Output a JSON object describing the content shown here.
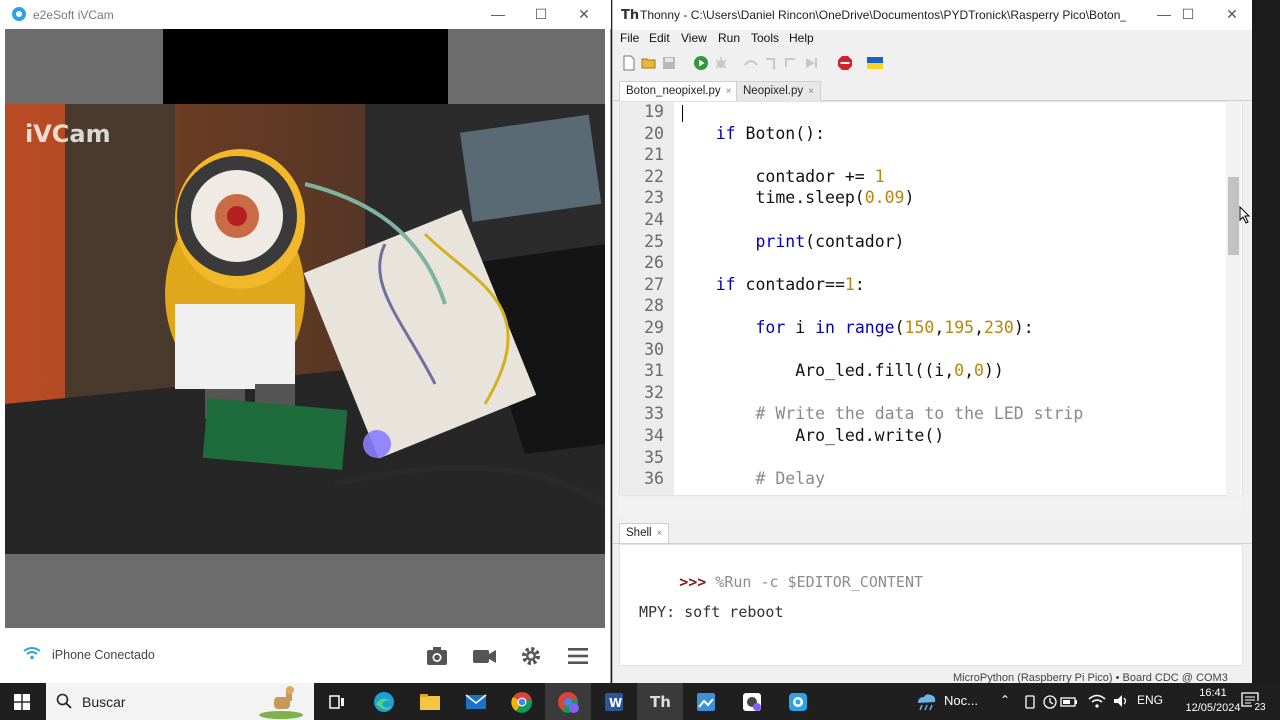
{
  "ivcam": {
    "title": "e2eSoft iVCam",
    "watermark": "iVCam",
    "status": "iPhone Conectado",
    "controls": {
      "minimize": "—",
      "maximize": "☐",
      "close": "✕"
    }
  },
  "thonny": {
    "title": "Thonny  -  C:\\Users\\Daniel Rincon\\OneDrive\\Documentos\\PYDTronick\\Rasperry Pico\\Boton_ne...",
    "menu": [
      "File",
      "Edit",
      "View",
      "Run",
      "Tools",
      "Help"
    ],
    "tabs": [
      {
        "label": "Boton_neopixel.py",
        "close": "×"
      },
      {
        "label": "Neopixel.py",
        "close": "×"
      }
    ],
    "code_lines": [
      {
        "n": "19",
        "text": ""
      },
      {
        "n": "20",
        "text": "    if Boton():"
      },
      {
        "n": "21",
        "text": ""
      },
      {
        "n": "22",
        "text": "        contador += 1"
      },
      {
        "n": "23",
        "text": "        time.sleep(0.09)"
      },
      {
        "n": "24",
        "text": ""
      },
      {
        "n": "25",
        "text": "        print(contador)"
      },
      {
        "n": "26",
        "text": ""
      },
      {
        "n": "27",
        "text": "    if contador==1:"
      },
      {
        "n": "28",
        "text": ""
      },
      {
        "n": "29",
        "text": "        for i in range(150,195,230):"
      },
      {
        "n": "30",
        "text": ""
      },
      {
        "n": "31",
        "text": "            Aro_led.fill((i,0,0))"
      },
      {
        "n": "32",
        "text": ""
      },
      {
        "n": "33",
        "text": "        # Write the data to the LED strip"
      },
      {
        "n": "34",
        "text": "            Aro_led.write()"
      },
      {
        "n": "35",
        "text": ""
      },
      {
        "n": "36",
        "text": "        # Delay"
      }
    ],
    "shell": {
      "tab_label": "Shell",
      "prompt": ">>>",
      "command": " %Run -c $EDITOR_CONTENT",
      "output": "MPY: soft reboot"
    },
    "statusbar": "MicroPython (Raspberry Pi Pico)  •  Board CDC @ COM3",
    "controls": {
      "minimize": "—",
      "maximize": "☐",
      "close": "✕"
    }
  },
  "taskbar": {
    "search_label": "Buscar",
    "tray_weather": "Noc...",
    "language": "ENG",
    "time": "16:41",
    "date": "12/05/2024",
    "notifications": "23"
  },
  "colors": {
    "keyword": "#0000b8",
    "number": "#b8860b",
    "comment": "#8a8a8a",
    "prompt": "#8b1a1a"
  }
}
